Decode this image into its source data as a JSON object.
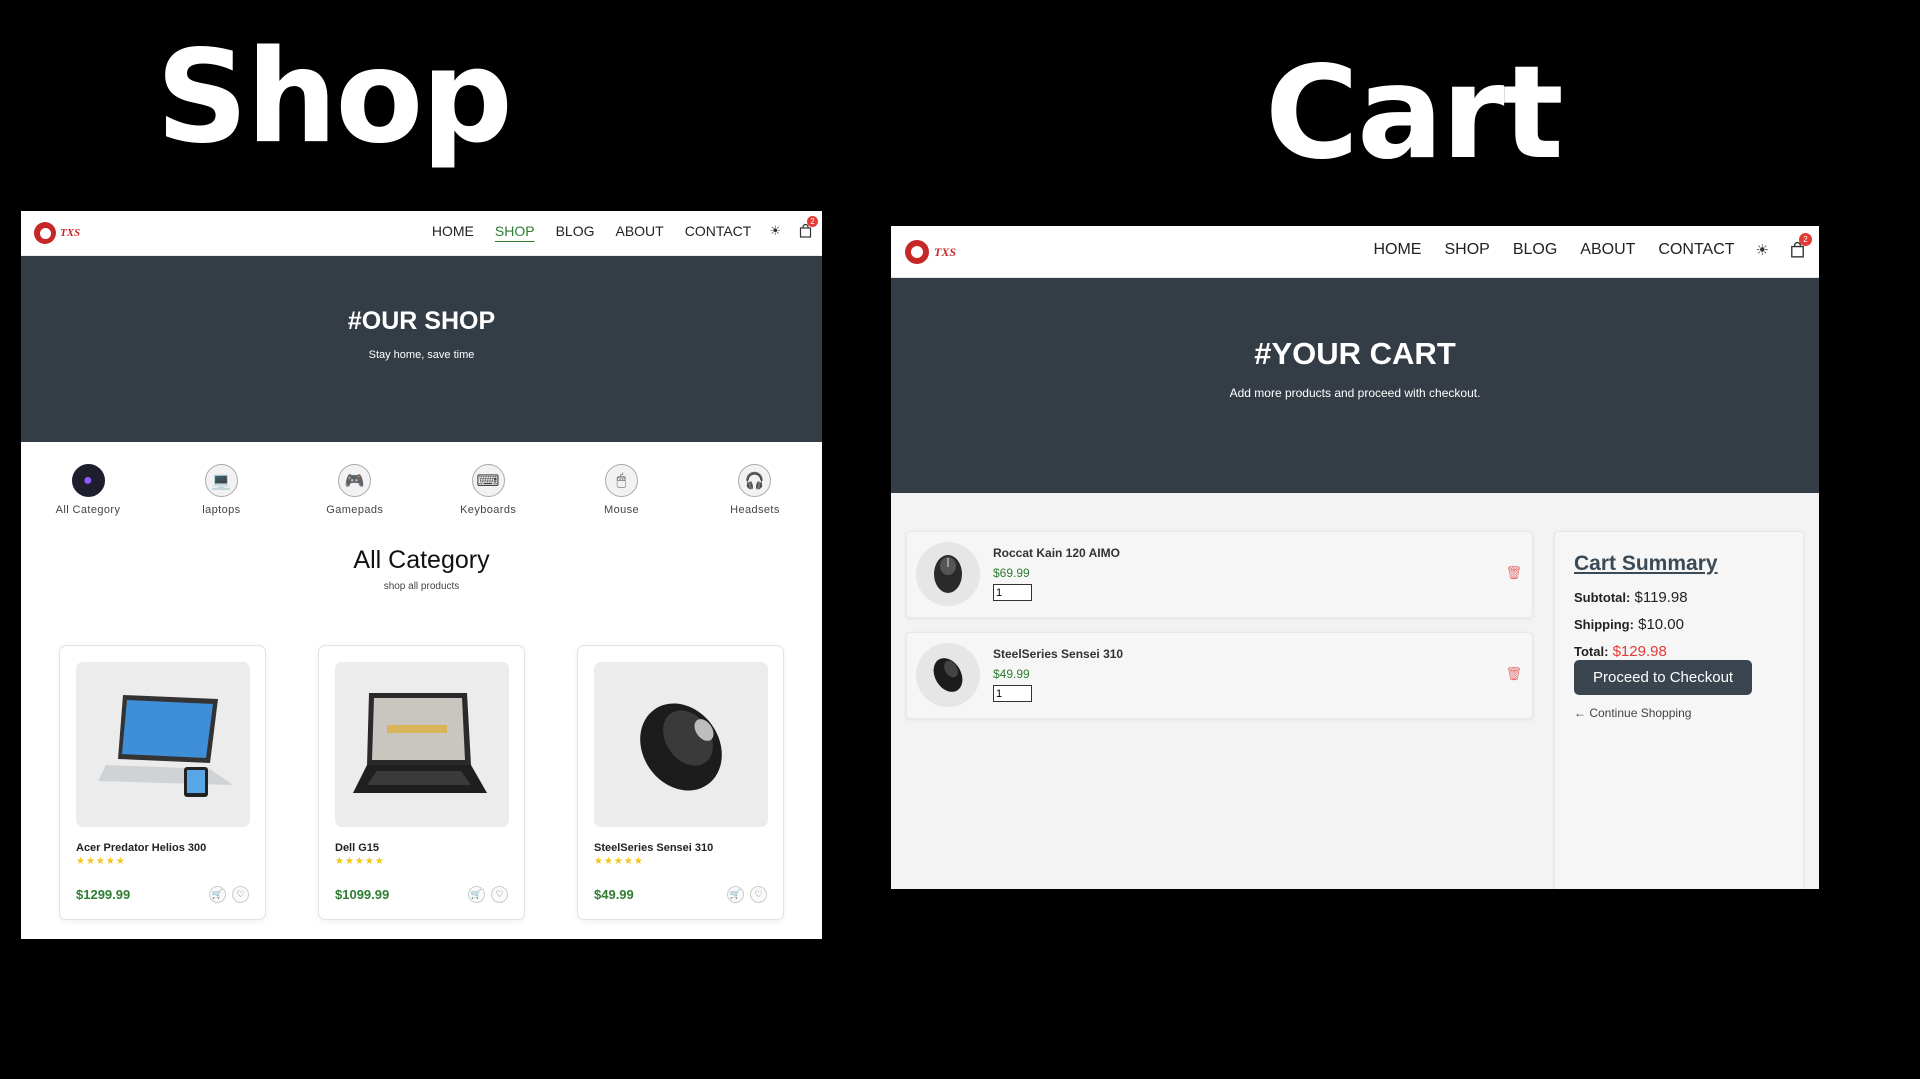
{
  "headings": {
    "shop": "Shop",
    "cart": "Cart"
  },
  "nav": {
    "logo_text": "TXS",
    "items": [
      "HOME",
      "SHOP",
      "BLOG",
      "ABOUT",
      "CONTACT"
    ],
    "cart_count": "2"
  },
  "shop": {
    "active_nav": "SHOP",
    "hero_title": "#OUR SHOP",
    "hero_subtitle": "Stay home, save time",
    "categories": [
      {
        "label": "All Category",
        "icon": "all-category-icon"
      },
      {
        "label": "laptops",
        "icon": "laptop-icon"
      },
      {
        "label": "Gamepads",
        "icon": "gamepad-icon"
      },
      {
        "label": "Keyboards",
        "icon": "keyboard-icon"
      },
      {
        "label": "Mouse",
        "icon": "mouse-icon"
      },
      {
        "label": "Headsets",
        "icon": "headset-icon"
      }
    ],
    "section_title": "All Category",
    "section_subtitle": "shop all products",
    "products": [
      {
        "name": "Acer Predator Helios 300",
        "stars": "★★★★★",
        "price": "$1299.99"
      },
      {
        "name": "Dell G15",
        "stars": "★★★★★",
        "price": "$1099.99"
      },
      {
        "name": "SteelSeries Sensei 310",
        "stars": "★★★★★",
        "price": "$49.99"
      }
    ]
  },
  "cart": {
    "hero_title": "#YOUR CART",
    "hero_subtitle": "Add more products and proceed with checkout.",
    "items": [
      {
        "name": "Roccat Kain 120 AIMO",
        "price": "$69.99",
        "qty": "1"
      },
      {
        "name": "SteelSeries Sensei 310",
        "price": "$49.99",
        "qty": "1"
      }
    ],
    "summary": {
      "title": "Cart Summary",
      "subtotal_label": "Subtotal:",
      "subtotal": "$119.98",
      "shipping_label": "Shipping:",
      "shipping": "$10.00",
      "total_label": "Total:",
      "total": "$129.98",
      "checkout_label": "Proceed to Checkout",
      "continue_label": "← Continue Shopping"
    }
  },
  "colors": {
    "hero_bg": "#343d45",
    "price_green": "#2e7d32",
    "accent_red": "#e53935",
    "star_yellow": "#f5c518"
  }
}
